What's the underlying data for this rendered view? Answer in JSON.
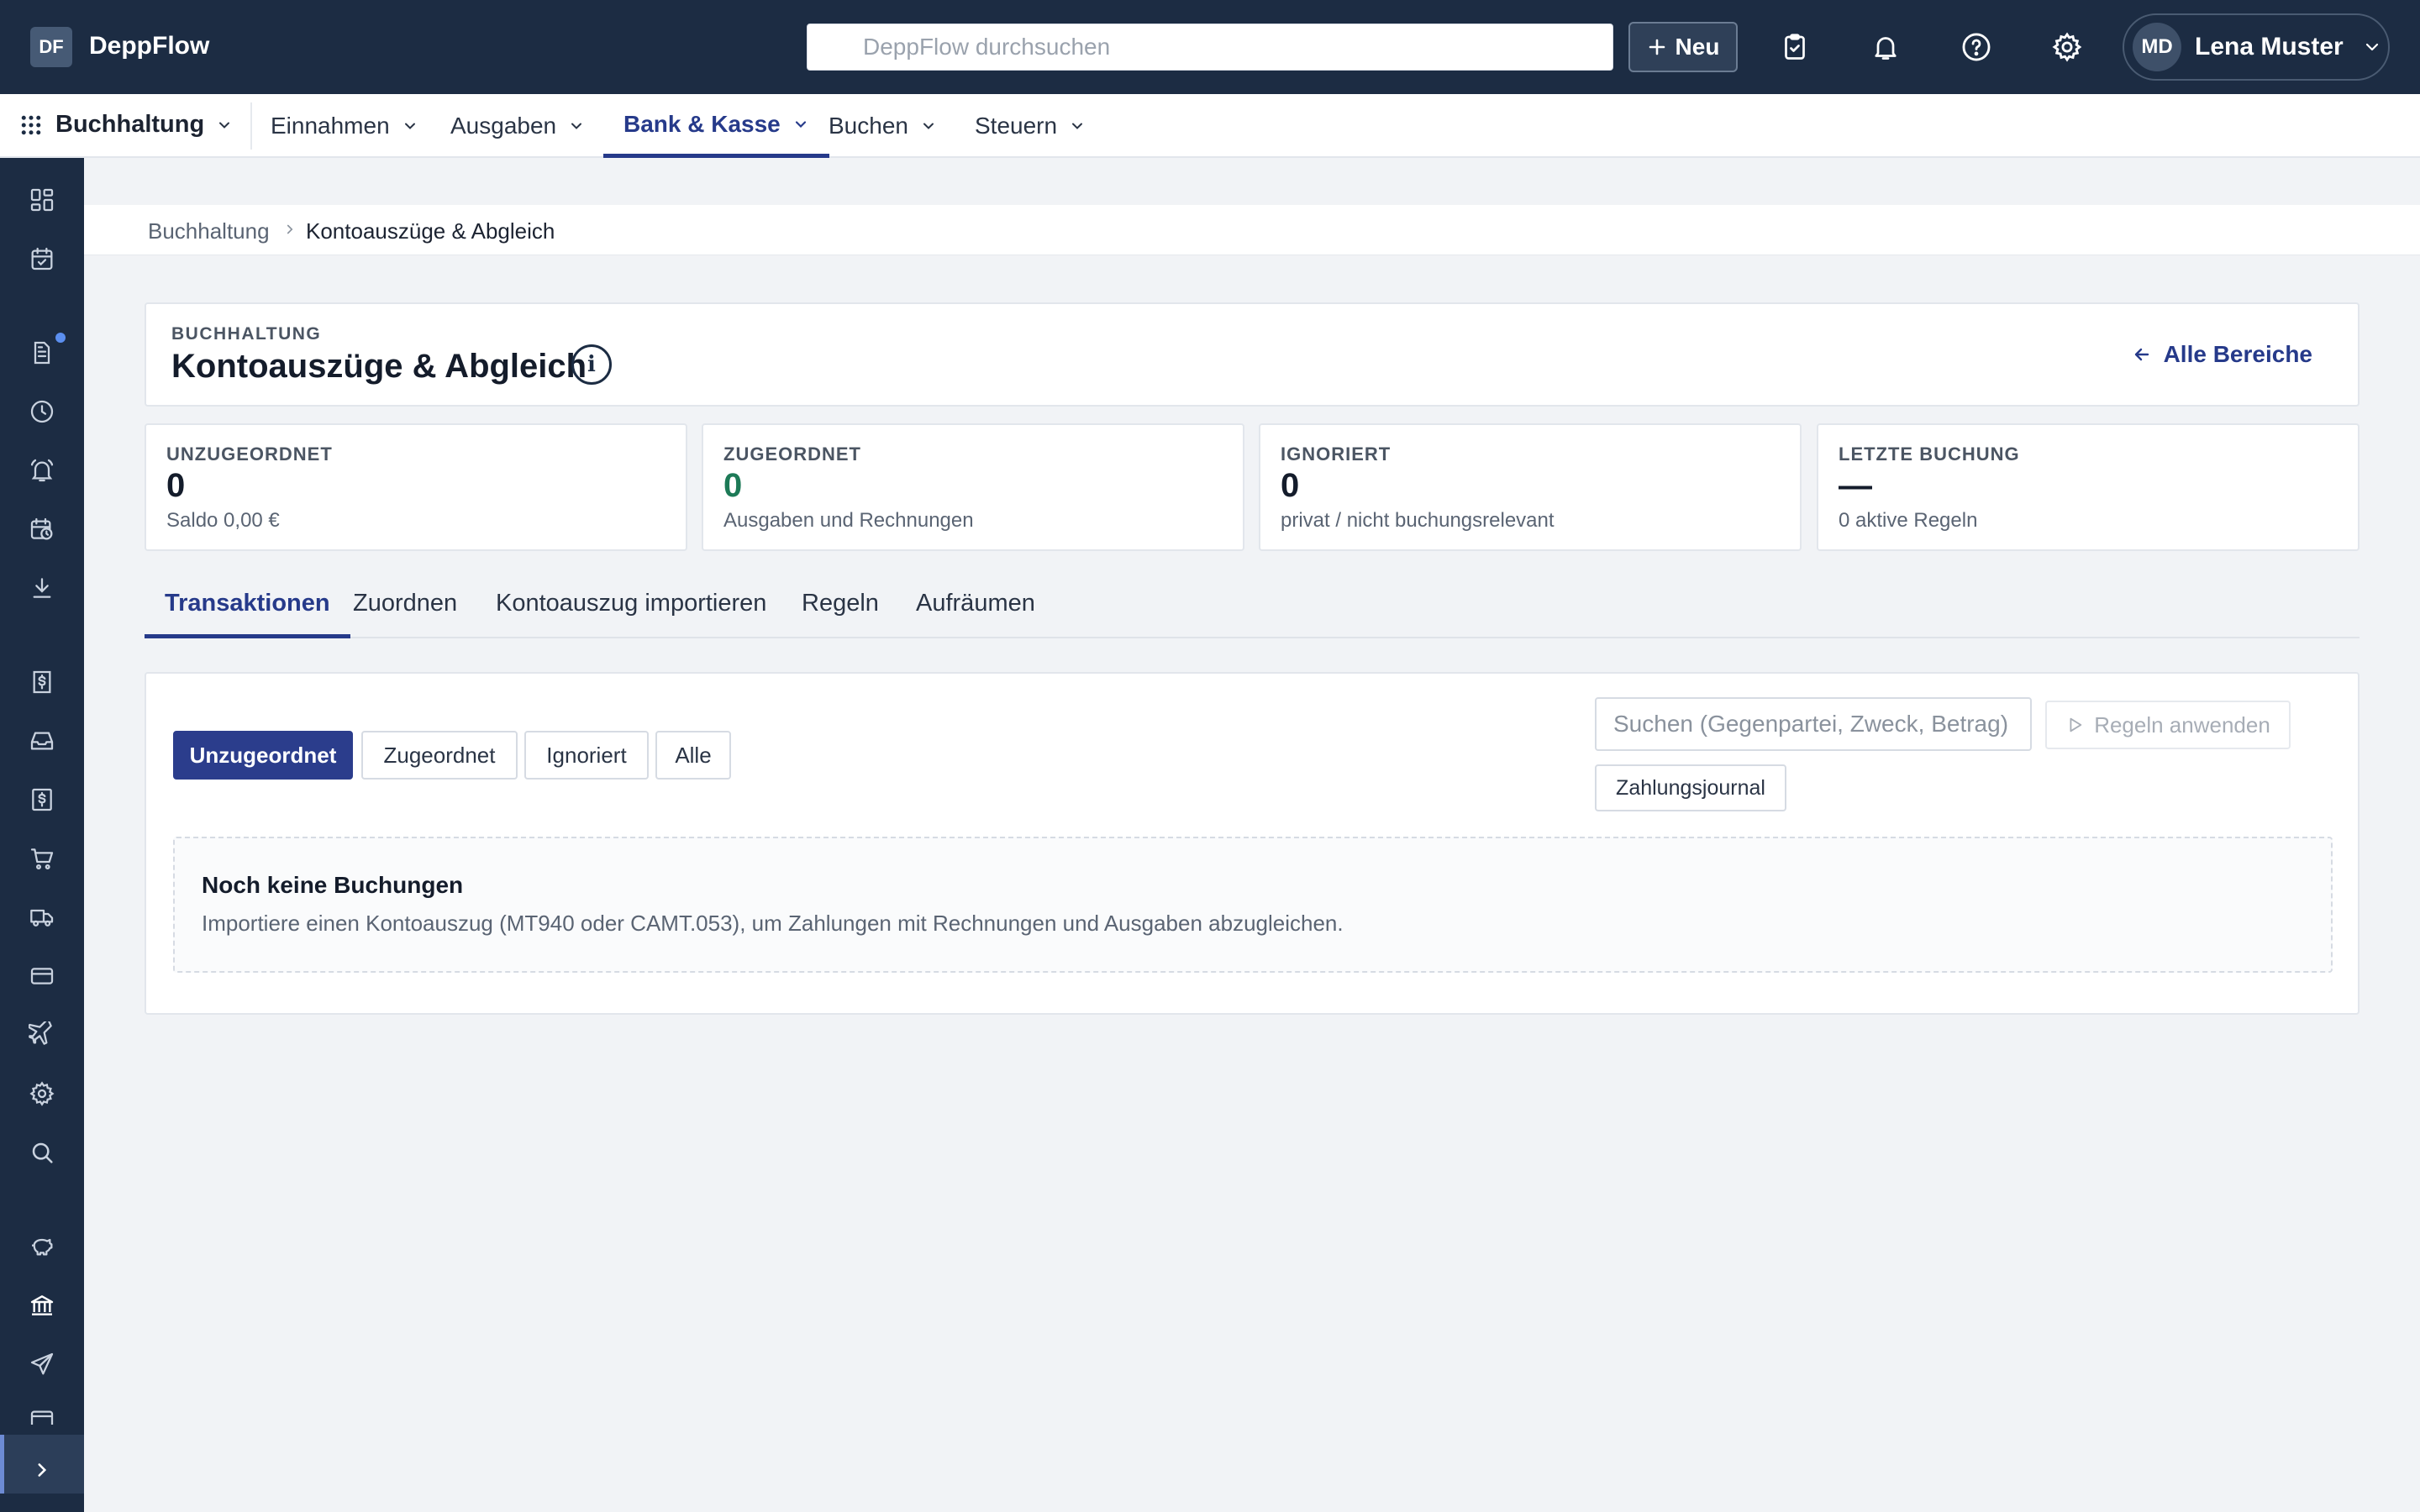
{
  "app": {
    "logo": "DF",
    "name": "DeppFlow"
  },
  "topbar": {
    "search_placeholder": "DeppFlow durchsuchen",
    "new_label": "Neu",
    "icons": [
      "clipboard-check-icon",
      "bell-icon",
      "help-icon",
      "gear-icon"
    ],
    "user": {
      "initials": "MD",
      "name": "Lena Muster"
    }
  },
  "module_nav": {
    "module": "Buchhaltung",
    "items": [
      {
        "label": "Einnahmen",
        "active": false
      },
      {
        "label": "Ausgaben",
        "active": false
      },
      {
        "label": "Bank & Kasse",
        "active": true
      },
      {
        "label": "Buchen",
        "active": false
      },
      {
        "label": "Steuern",
        "active": false
      }
    ]
  },
  "sidebar": {
    "icons": [
      "dashboard-icon",
      "calendar-check-icon",
      "document-icon",
      "clock-icon",
      "bell-alert-icon",
      "calendar-clock-icon",
      "download-icon",
      "invoice-dollar-icon",
      "inbox-icon",
      "receipt-dollar-icon",
      "cart-icon",
      "truck-icon",
      "credit-card-icon",
      "plane-icon",
      "settings-icon",
      "search-icon",
      "piggy-bank-icon",
      "bank-icon",
      "send-icon",
      "wallet-icon",
      "expand-icon"
    ],
    "active": "bank-icon"
  },
  "breadcrumb": {
    "parent": "Buchhaltung",
    "current": "Kontoauszüge & Abgleich"
  },
  "header": {
    "eyebrow": "BUCHHALTUNG",
    "title": "Kontoauszüge & Abgleich",
    "info_glyph": "i",
    "back_label": "Alle Bereiche"
  },
  "stats": [
    {
      "label": "UNZUGEORDNET",
      "value": "0",
      "sub": "Saldo 0,00 €"
    },
    {
      "label": "ZUGEORDNET",
      "value": "0",
      "sub": "Ausgaben und Rechnungen",
      "color": "#1d7a57"
    },
    {
      "label": "IGNORIERT",
      "value": "0",
      "sub": "privat / nicht buchungsrelevant"
    },
    {
      "label": "LETZTE BUCHUNG",
      "value": "—",
      "sub": "0 aktive Regeln"
    }
  ],
  "tabs": [
    {
      "label": "Transaktionen",
      "active": true
    },
    {
      "label": "Zuordnen",
      "active": false
    },
    {
      "label": "Kontoauszug importieren",
      "active": false
    },
    {
      "label": "Regeln",
      "active": false
    },
    {
      "label": "Aufräumen",
      "active": false
    }
  ],
  "filters": [
    {
      "label": "Unzugeordnet",
      "active": true
    },
    {
      "label": "Zugeordnet",
      "active": false
    },
    {
      "label": "Ignoriert",
      "active": false
    },
    {
      "label": "Alle",
      "active": false
    }
  ],
  "transactions": {
    "search_placeholder": "Suchen (Gegenpartei, Zweck, Betrag)",
    "apply_rules_label": "Regeln anwenden",
    "journal_label": "Zahlungsjournal",
    "empty_title": "Noch keine Buchungen",
    "empty_text": "Importiere einen Kontoauszug (MT940 oder CAMT.053), um Zahlungen mit Rechnungen und Ausgaben abzugleichen."
  },
  "colors": {
    "navy": "#1c2c43",
    "accent": "#263a8a",
    "primary_button": "#2b3d8c",
    "success": "#1d7a57"
  }
}
